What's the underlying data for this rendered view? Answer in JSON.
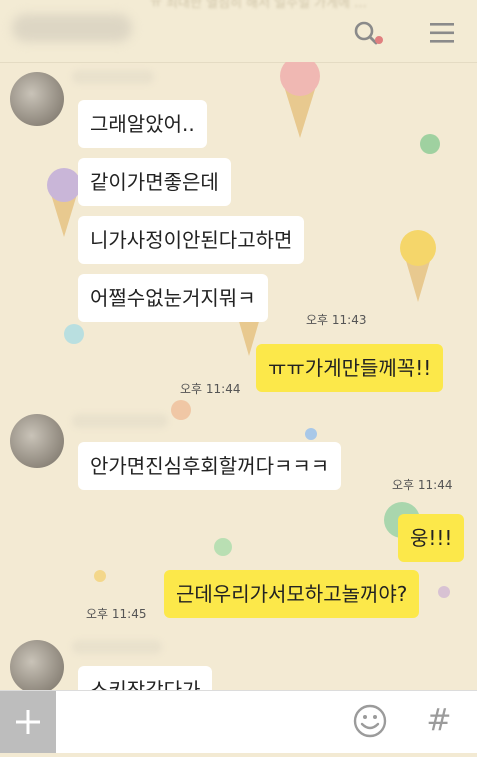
{
  "header": {
    "banner_text": "ㅠ 최대한 열심히 해서 일주일 가게에 ...",
    "search_icon": "search-icon",
    "menu_icon": "menu-icon"
  },
  "messages": [
    {
      "side": "in",
      "text": "그래알았어.."
    },
    {
      "side": "in",
      "text": "같이가면좋은데"
    },
    {
      "side": "in",
      "text": "니가사정이안된다고하면"
    },
    {
      "side": "in",
      "text": "어쩔수없눈거지뭐ㅋ",
      "time": "오후 11:43"
    },
    {
      "side": "out",
      "text": "ㅠㅠ가게만들께꼭!!",
      "time": "오후 11:44"
    },
    {
      "side": "in",
      "text": "안가면진심후회할꺼다ㅋㅋㅋ",
      "time": "오후 11:44"
    },
    {
      "side": "out",
      "text": "웅!!!"
    },
    {
      "side": "out",
      "text": "근데우리가서모하고놀꺼야?",
      "time": "오후 11:45"
    },
    {
      "side": "in",
      "text": "스키장갔다가"
    }
  ],
  "input_bar": {
    "plus_icon": "plus-icon",
    "emoji_icon": "emoji-icon",
    "hash_label": "#"
  },
  "colors": {
    "background": "#f3ead3",
    "incoming_bubble": "#ffffff",
    "outgoing_bubble": "#fce84a"
  }
}
